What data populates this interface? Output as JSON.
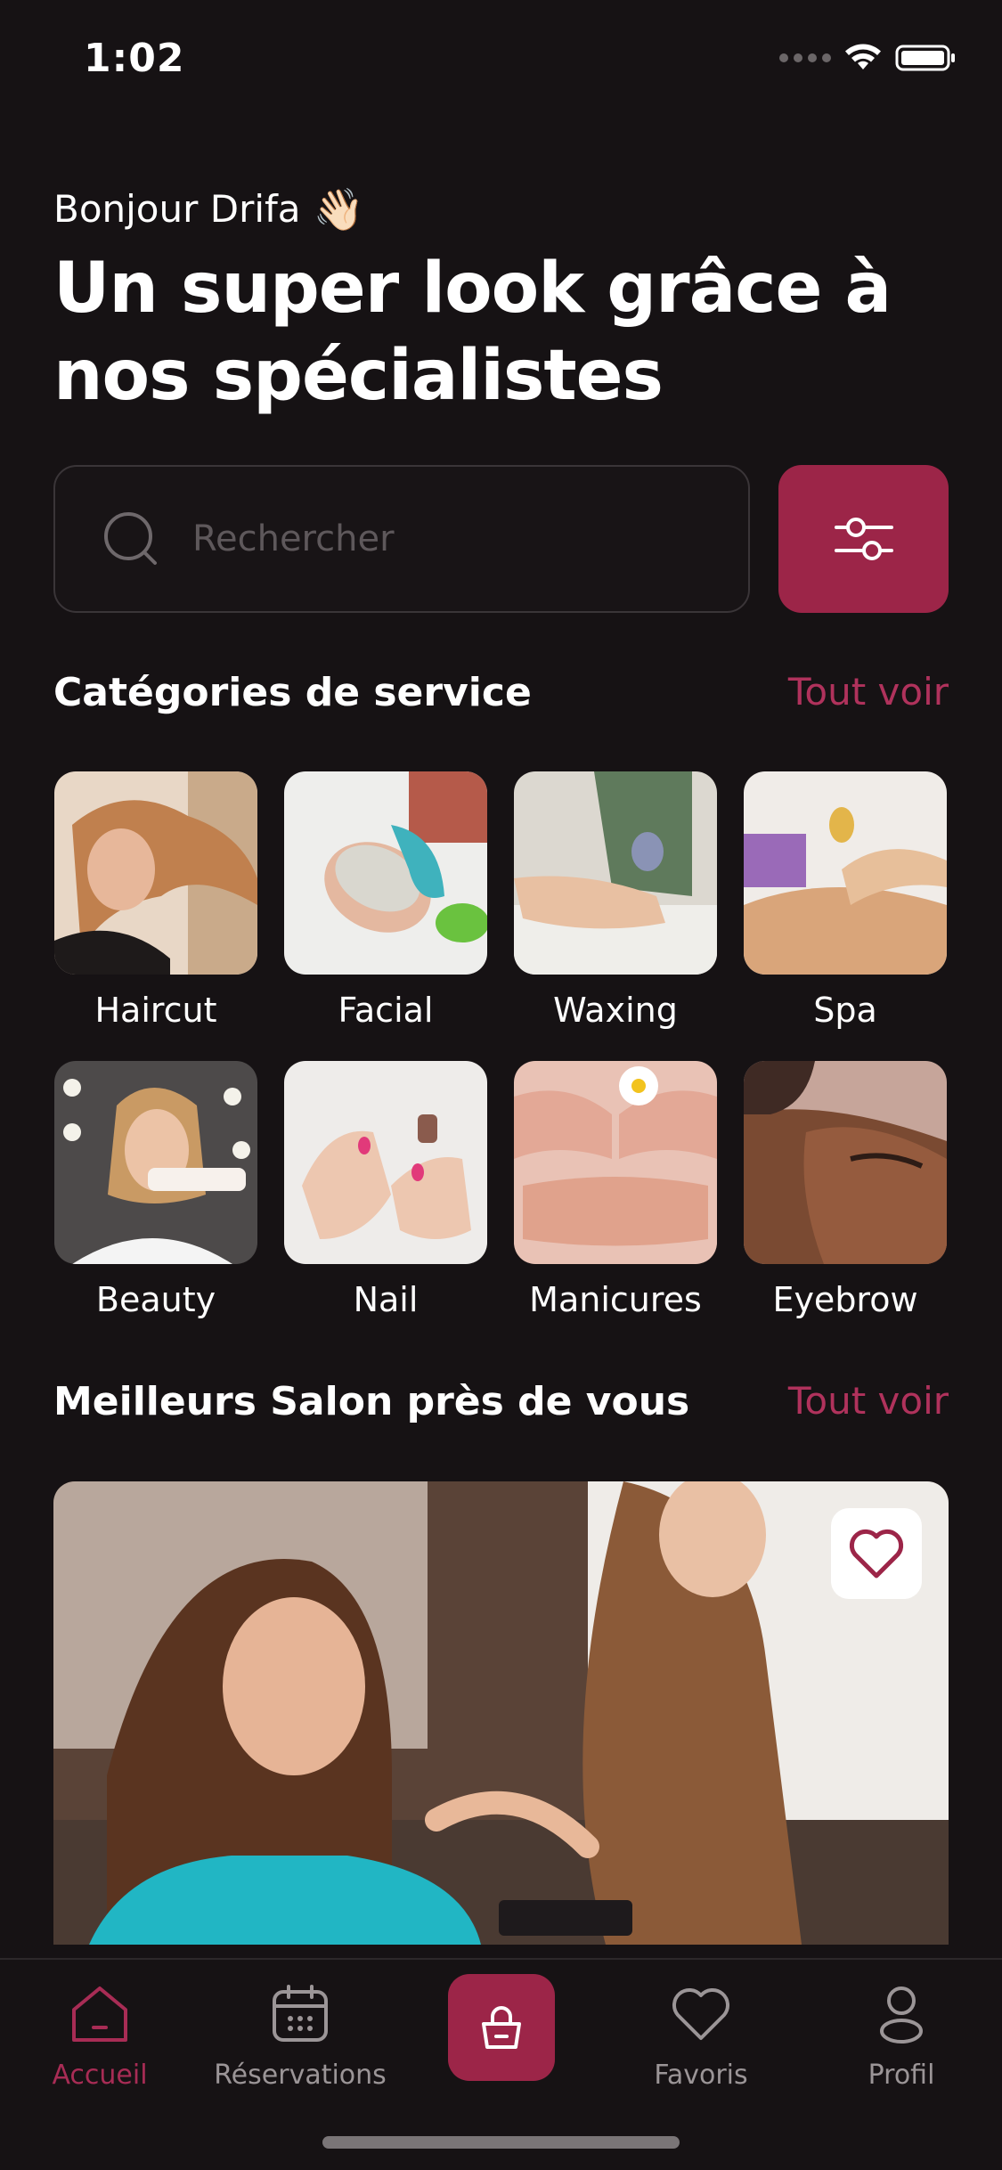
{
  "status_bar": {
    "time": "1:02"
  },
  "header": {
    "greeting": "Bonjour Drifa",
    "wave_emoji": "👋🏻",
    "headline": "Un super look grâce à nos spécialistes"
  },
  "search": {
    "placeholder": "Rechercher"
  },
  "categories_section": {
    "title": "Catégories de service",
    "see_all": "Tout voir",
    "items": [
      {
        "label": "Haircut"
      },
      {
        "label": "Facial"
      },
      {
        "label": "Waxing"
      },
      {
        "label": "Spa"
      },
      {
        "label": "Beauty"
      },
      {
        "label": "Nail"
      },
      {
        "label": "Manicures"
      },
      {
        "label": "Eyebrow"
      }
    ]
  },
  "salons_section": {
    "title": "Meilleurs Salon près de vous",
    "see_all": "Tout voir"
  },
  "tab_bar": {
    "items": [
      {
        "label": "Accueil",
        "icon": "home-icon",
        "active": true
      },
      {
        "label": "Réservations",
        "icon": "calendar-icon",
        "active": false
      },
      {
        "label": "",
        "icon": "shopping-bag-icon",
        "active": false
      },
      {
        "label": "Favoris",
        "icon": "heart-icon",
        "active": false
      },
      {
        "label": "Profil",
        "icon": "user-icon",
        "active": false
      }
    ]
  },
  "colors": {
    "background": "#161214",
    "accent": "#9c2548",
    "accent_text": "#b0325c",
    "muted_text": "#9b9597"
  }
}
